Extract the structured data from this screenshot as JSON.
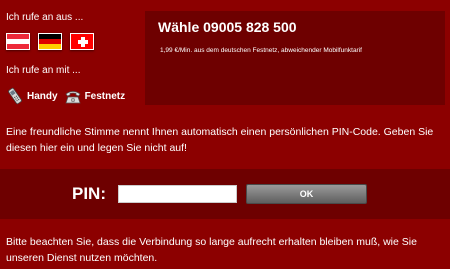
{
  "left": {
    "call_from_label": "Ich rufe an aus ...",
    "flags": [
      {
        "country": "Österreich",
        "icon": "flag-austria-icon"
      },
      {
        "country": "Deutschland",
        "icon": "flag-germany-icon"
      },
      {
        "country": "Schweiz",
        "icon": "flag-switzerland-icon"
      }
    ],
    "call_with_label": "Ich rufe an mit ...",
    "phones": [
      {
        "label": "Handy",
        "icon": "mobile-phone-icon"
      },
      {
        "label": "Festnetz",
        "icon": "landline-phone-icon"
      }
    ]
  },
  "dial": {
    "title": "Wähle 09005 828 500",
    "subtitle": "1,99 €/Min. aus dem deutschen Festnetz, abweichender Mobilfunktarif"
  },
  "intro_text": "Eine freundliche Stimme nennt Ihnen automatisch einen persönlichen PIN-Code. Geben Sie diesen hier ein und legen Sie nicht auf!",
  "pin": {
    "label": "PIN:",
    "value": "",
    "ok_label": "OK"
  },
  "note_text": "Bitte beachten Sie, dass die Verbindung so lange aufrecht erhalten bleiben muß, wie Sie unseren Dienst nutzen möchten.",
  "colors": {
    "background": "#8c0000",
    "panel": "#6e0000",
    "button": "#7a7a7a"
  }
}
